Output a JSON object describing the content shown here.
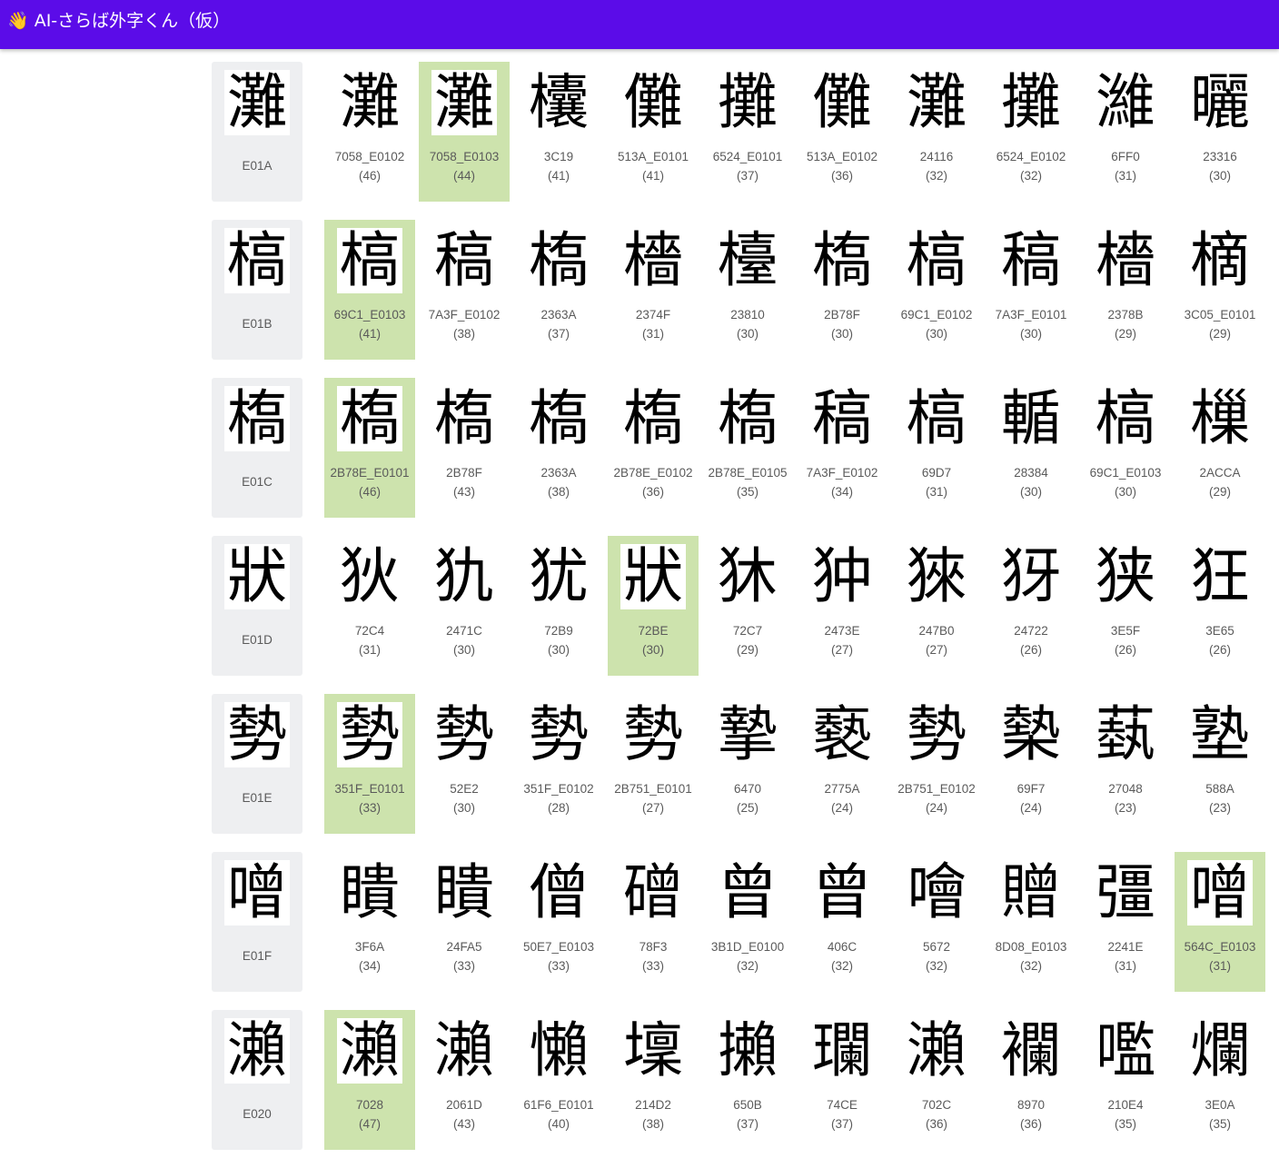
{
  "app": {
    "title": "👋 AI-さらば外字くん（仮）"
  },
  "rows": [
    {
      "query": {
        "glyph": "灘",
        "code": "E01A"
      },
      "selected_index": 1,
      "candidates": [
        {
          "glyph": "灘",
          "code": "7058_E0102",
          "score": "(46)"
        },
        {
          "glyph": "灘",
          "code": "7058_E0103",
          "score": "(44)"
        },
        {
          "glyph": "欜",
          "code": "3C19",
          "score": "(41)"
        },
        {
          "glyph": "儺",
          "code": "513A_E0101",
          "score": "(41)"
        },
        {
          "glyph": "攤",
          "code": "6524_E0101",
          "score": "(37)"
        },
        {
          "glyph": "儺",
          "code": "513A_E0102",
          "score": "(36)"
        },
        {
          "glyph": "灘",
          "code": "24116",
          "score": "(32)"
        },
        {
          "glyph": "攤",
          "code": "6524_E0102",
          "score": "(32)"
        },
        {
          "glyph": "濰",
          "code": "6FF0",
          "score": "(31)"
        },
        {
          "glyph": "曬",
          "code": "23316",
          "score": "(30)"
        }
      ]
    },
    {
      "query": {
        "glyph": "槁",
        "code": "E01B"
      },
      "selected_index": 0,
      "candidates": [
        {
          "glyph": "槁",
          "code": "69C1_E0103",
          "score": "(41)"
        },
        {
          "glyph": "稿",
          "code": "7A3F_E0102",
          "score": "(38)"
        },
        {
          "glyph": "槗",
          "code": "2363A",
          "score": "(37)"
        },
        {
          "glyph": "檣",
          "code": "2374F",
          "score": "(31)"
        },
        {
          "glyph": "檯",
          "code": "23810",
          "score": "(30)"
        },
        {
          "glyph": "槗",
          "code": "2B78F",
          "score": "(30)"
        },
        {
          "glyph": "槁",
          "code": "69C1_E0102",
          "score": "(30)"
        },
        {
          "glyph": "稿",
          "code": "7A3F_E0101",
          "score": "(30)"
        },
        {
          "glyph": "檣",
          "code": "2378B",
          "score": "(29)"
        },
        {
          "glyph": "樀",
          "code": "3C05_E0101",
          "score": "(29)"
        }
      ]
    },
    {
      "query": {
        "glyph": "槗",
        "code": "E01C"
      },
      "selected_index": 0,
      "candidates": [
        {
          "glyph": "槗",
          "code": "2B78E_E0101",
          "score": "(46)"
        },
        {
          "glyph": "槗",
          "code": "2B78F",
          "score": "(43)"
        },
        {
          "glyph": "槗",
          "code": "2363A",
          "score": "(38)"
        },
        {
          "glyph": "槗",
          "code": "2B78E_E0102",
          "score": "(36)"
        },
        {
          "glyph": "槗",
          "code": "2B78E_E0105",
          "score": "(35)"
        },
        {
          "glyph": "稿",
          "code": "7A3F_E0102",
          "score": "(34)"
        },
        {
          "glyph": "槁",
          "code": "69D7",
          "score": "(31)"
        },
        {
          "glyph": "輴",
          "code": "28384",
          "score": "(30)"
        },
        {
          "glyph": "槁",
          "code": "69C1_E0103",
          "score": "(30)"
        },
        {
          "glyph": "樔",
          "code": "2ACCA",
          "score": "(29)"
        }
      ]
    },
    {
      "query": {
        "glyph": "狀",
        "code": "E01D"
      },
      "selected_index": 3,
      "candidates": [
        {
          "glyph": "狄",
          "code": "72C4",
          "score": "(31)"
        },
        {
          "glyph": "犰",
          "code": "2471C",
          "score": "(30)"
        },
        {
          "glyph": "犹",
          "code": "72B9",
          "score": "(30)"
        },
        {
          "glyph": "狀",
          "code": "72BE",
          "score": "(30)"
        },
        {
          "glyph": "狇",
          "code": "72C7",
          "score": "(29)"
        },
        {
          "glyph": "狆",
          "code": "2473E",
          "score": "(27)"
        },
        {
          "glyph": "猍",
          "code": "247B0",
          "score": "(27)"
        },
        {
          "glyph": "犽",
          "code": "24722",
          "score": "(26)"
        },
        {
          "glyph": "狭",
          "code": "3E5F",
          "score": "(26)"
        },
        {
          "glyph": "狂",
          "code": "3E65",
          "score": "(26)"
        }
      ]
    },
    {
      "query": {
        "glyph": "勢",
        "code": "E01E"
      },
      "selected_index": 0,
      "candidates": [
        {
          "glyph": "勢",
          "code": "351F_E0101",
          "score": "(33)"
        },
        {
          "glyph": "勢",
          "code": "52E2",
          "score": "(30)"
        },
        {
          "glyph": "勢",
          "code": "351F_E0102",
          "score": "(28)"
        },
        {
          "glyph": "勢",
          "code": "2B751_E0101",
          "score": "(27)"
        },
        {
          "glyph": "摯",
          "code": "6470",
          "score": "(25)"
        },
        {
          "glyph": "褻",
          "code": "2775A",
          "score": "(24)"
        },
        {
          "glyph": "勢",
          "code": "2B751_E0102",
          "score": "(24)"
        },
        {
          "glyph": "槷",
          "code": "69F7",
          "score": "(24)"
        },
        {
          "glyph": "蓺",
          "code": "27048",
          "score": "(23)"
        },
        {
          "glyph": "塾",
          "code": "588A",
          "score": "(23)"
        }
      ]
    },
    {
      "query": {
        "glyph": "噌",
        "code": "E01F"
      },
      "selected_index": 9,
      "candidates": [
        {
          "glyph": "瞶",
          "code": "3F6A",
          "score": "(34)"
        },
        {
          "glyph": "瞶",
          "code": "24FA5",
          "score": "(33)"
        },
        {
          "glyph": "僧",
          "code": "50E7_E0103",
          "score": "(33)"
        },
        {
          "glyph": "磳",
          "code": "78F3",
          "score": "(33)"
        },
        {
          "glyph": "曾",
          "code": "3B1D_E0100",
          "score": "(32)"
        },
        {
          "glyph": "曾",
          "code": "406C",
          "score": "(32)"
        },
        {
          "glyph": "噲",
          "code": "5672",
          "score": "(32)"
        },
        {
          "glyph": "贈",
          "code": "8D08_E0103",
          "score": "(32)"
        },
        {
          "glyph": "彊",
          "code": "2241E",
          "score": "(31)"
        },
        {
          "glyph": "噌",
          "code": "564C_E0103",
          "score": "(31)"
        }
      ]
    },
    {
      "query": {
        "glyph": "瀨",
        "code": "E020"
      },
      "selected_index": 0,
      "candidates": [
        {
          "glyph": "瀨",
          "code": "7028",
          "score": "(47)"
        },
        {
          "glyph": "瀨",
          "code": "2061D",
          "score": "(43)"
        },
        {
          "glyph": "懶",
          "code": "61F6_E0101",
          "score": "(40)"
        },
        {
          "glyph": "壈",
          "code": "214D2",
          "score": "(38)"
        },
        {
          "glyph": "攋",
          "code": "650B",
          "score": "(37)"
        },
        {
          "glyph": "瓓",
          "code": "74CE",
          "score": "(37)"
        },
        {
          "glyph": "瀨",
          "code": "702C",
          "score": "(36)"
        },
        {
          "glyph": "襴",
          "code": "8970",
          "score": "(36)"
        },
        {
          "glyph": "嚂",
          "code": "210E4",
          "score": "(35)"
        },
        {
          "glyph": "爛",
          "code": "3E0A",
          "score": "(35)"
        }
      ]
    }
  ]
}
